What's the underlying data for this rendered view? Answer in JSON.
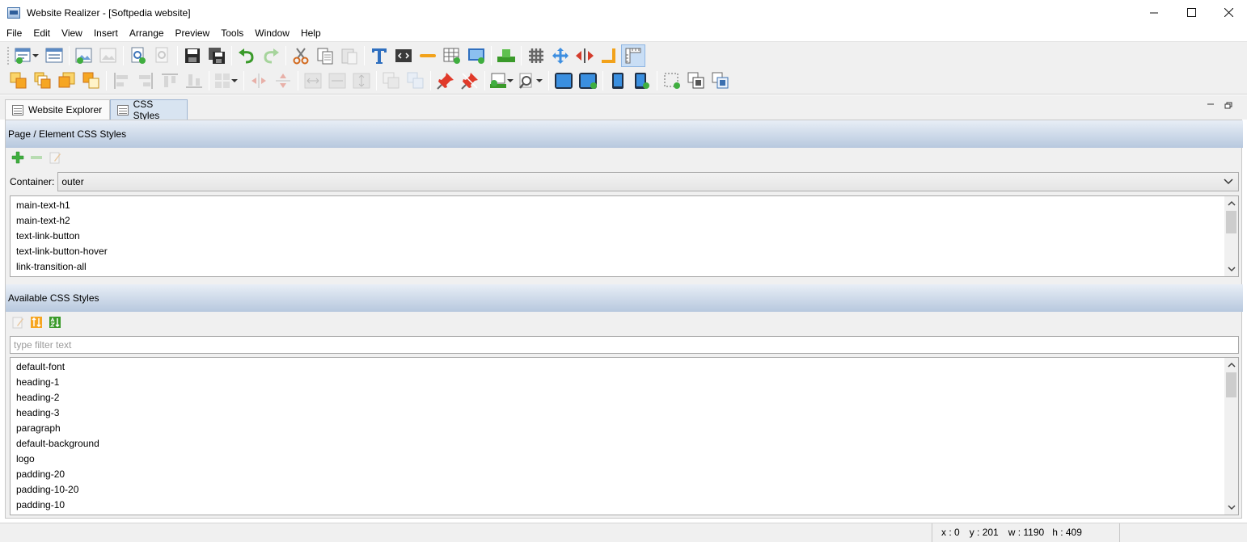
{
  "window": {
    "title": "Website Realizer - [Softpedia website]",
    "controls": [
      "minimize",
      "maximize",
      "close"
    ]
  },
  "menu": [
    "File",
    "Edit",
    "View",
    "Insert",
    "Arrange",
    "Preview",
    "Tools",
    "Window",
    "Help"
  ],
  "toolbar": {
    "row1_icons": [
      "new-page-icon",
      "page-properties-icon",
      "new-image-icon",
      "image-disabled-icon",
      "preview-page-icon",
      "preview-disabled-icon",
      "save-icon",
      "save-all-icon",
      "undo-icon",
      "redo-icon",
      "cut-icon",
      "copy-icon",
      "paste-icon",
      "text-icon",
      "html-code-icon",
      "line-icon",
      "table-icon",
      "image-insert-icon",
      "publish-icon",
      "grid-icon",
      "move-icon",
      "resize-horizontal-icon",
      "corner-icon",
      "ruler-icon"
    ],
    "row2_icons": [
      "bring-to-front-icon",
      "bring-forward-icon",
      "send-backward-icon",
      "send-to-back-icon",
      "align-left-icon",
      "align-right-icon",
      "align-top-icon",
      "align-bottom-icon",
      "layout-grid-icon",
      "distribute-horizontal-icon",
      "distribute-vertical-icon",
      "same-width-icon",
      "same-size-icon",
      "same-height-icon",
      "group-icon",
      "ungroup-icon",
      "pin-icon",
      "unpin-icon",
      "upload-icon",
      "zoom-icon",
      "tablet-landscape-icon",
      "tablet-landscape-add-icon",
      "phone-portrait-icon",
      "phone-portrait-add-icon",
      "select-area-icon",
      "screenshot-icon",
      "screenshot-alt-icon"
    ]
  },
  "tabs": [
    {
      "label": "Website Explorer",
      "active": false
    },
    {
      "label": "CSS Styles",
      "active": true
    }
  ],
  "page_styles": {
    "header": "Page / Element CSS Styles",
    "toolbar": [
      "add-icon",
      "remove-icon",
      "edit-icon"
    ],
    "container_label": "Container:",
    "container_value": "outer",
    "items": [
      "main-text-h1",
      "main-text-h2",
      "text-link-button",
      "text-link-button-hover",
      "link-transition-all"
    ]
  },
  "available_styles": {
    "header": "Available CSS Styles",
    "toolbar": [
      "edit-icon",
      "sort-icon",
      "sort-az-icon"
    ],
    "filter_placeholder": "type filter text",
    "filter_value": "",
    "items": [
      "default-font",
      "heading-1",
      "heading-2",
      "heading-3",
      "paragraph",
      "default-background",
      "logo",
      "padding-20",
      "padding-10-20",
      "padding-10"
    ]
  },
  "status": {
    "x": "x : 0",
    "y": "y : 201",
    "w": "w : 1190",
    "h": "h : 409"
  },
  "colors": {
    "section_header_top": "#e8eef6",
    "section_header_bottom": "#b7c8de",
    "active_tab": "#d8e4f1",
    "accent_blue": "#2f6fbf"
  }
}
